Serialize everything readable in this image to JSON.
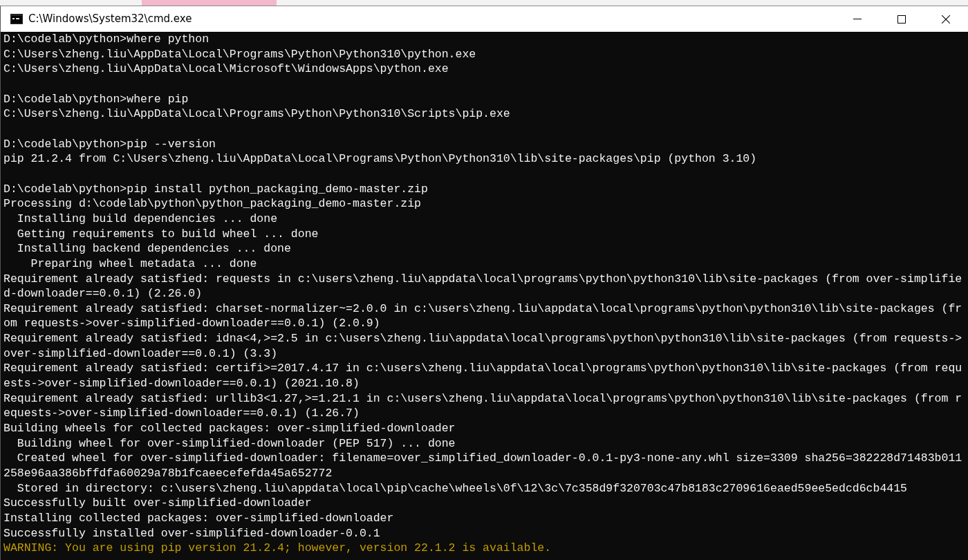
{
  "window": {
    "title": "C:\\Windows\\System32\\cmd.exe"
  },
  "console": {
    "blocks": [
      {
        "lines": [
          {
            "kind": "normal",
            "text": "D:\\codelab\\python>where python"
          },
          {
            "kind": "normal",
            "text": "C:\\Users\\zheng.liu\\AppData\\Local\\Programs\\Python\\Python310\\python.exe"
          },
          {
            "kind": "normal",
            "text": "C:\\Users\\zheng.liu\\AppData\\Local\\Microsoft\\WindowsApps\\python.exe"
          }
        ]
      },
      {
        "lines": [
          {
            "kind": "normal",
            "text": "D:\\codelab\\python>where pip"
          },
          {
            "kind": "normal",
            "text": "C:\\Users\\zheng.liu\\AppData\\Local\\Programs\\Python\\Python310\\Scripts\\pip.exe"
          }
        ]
      },
      {
        "lines": [
          {
            "kind": "normal",
            "text": "D:\\codelab\\python>pip --version"
          },
          {
            "kind": "normal",
            "text": "pip 21.2.4 from C:\\Users\\zheng.liu\\AppData\\Local\\Programs\\Python\\Python310\\lib\\site-packages\\pip (python 3.10)"
          }
        ]
      },
      {
        "lines": [
          {
            "kind": "normal",
            "text": "D:\\codelab\\python>pip install python_packaging_demo-master.zip"
          },
          {
            "kind": "normal",
            "text": "Processing d:\\codelab\\python\\python_packaging_demo-master.zip"
          },
          {
            "kind": "normal",
            "text": "  Installing build dependencies ... done"
          },
          {
            "kind": "normal",
            "text": "  Getting requirements to build wheel ... done"
          },
          {
            "kind": "normal",
            "text": "  Installing backend dependencies ... done"
          },
          {
            "kind": "normal",
            "text": "    Preparing wheel metadata ... done"
          },
          {
            "kind": "normal",
            "text": "Requirement already satisfied: requests in c:\\users\\zheng.liu\\appdata\\local\\programs\\python\\python310\\lib\\site-packages (from over-simplifie"
          },
          {
            "kind": "normal",
            "text": "d-downloader==0.0.1) (2.26.0)"
          },
          {
            "kind": "normal",
            "text": "Requirement already satisfied: charset-normalizer~=2.0.0 in c:\\users\\zheng.liu\\appdata\\local\\programs\\python\\python310\\lib\\site-packages (fr"
          },
          {
            "kind": "normal",
            "text": "om requests->over-simplified-downloader==0.0.1) (2.0.9)"
          },
          {
            "kind": "normal",
            "text": "Requirement already satisfied: idna<4,>=2.5 in c:\\users\\zheng.liu\\appdata\\local\\programs\\python\\python310\\lib\\site-packages (from requests->"
          },
          {
            "kind": "normal",
            "text": "over-simplified-downloader==0.0.1) (3.3)"
          },
          {
            "kind": "normal",
            "text": "Requirement already satisfied: certifi>=2017.4.17 in c:\\users\\zheng.liu\\appdata\\local\\programs\\python\\python310\\lib\\site-packages (from requ"
          },
          {
            "kind": "normal",
            "text": "ests->over-simplified-downloader==0.0.1) (2021.10.8)"
          },
          {
            "kind": "normal",
            "text": "Requirement already satisfied: urllib3<1.27,>=1.21.1 in c:\\users\\zheng.liu\\appdata\\local\\programs\\python\\python310\\lib\\site-packages (from r"
          },
          {
            "kind": "normal",
            "text": "equests->over-simplified-downloader==0.0.1) (1.26.7)"
          },
          {
            "kind": "normal",
            "text": "Building wheels for collected packages: over-simplified-downloader"
          },
          {
            "kind": "normal",
            "text": "  Building wheel for over-simplified-downloader (PEP 517) ... done"
          },
          {
            "kind": "normal",
            "text": "  Created wheel for over-simplified-downloader: filename=over_simplified_downloader-0.0.1-py3-none-any.whl size=3309 sha256=382228d71483b011"
          },
          {
            "kind": "normal",
            "text": "258e96aa386bffdfa60029a78b1fcaeecefefda45a652772"
          },
          {
            "kind": "normal",
            "text": "  Stored in directory: c:\\users\\zheng.liu\\appdata\\local\\pip\\cache\\wheels\\0f\\12\\3c\\7c358d9f320703c47b8183c2709616eaed59ee5edcd6cb4415"
          },
          {
            "kind": "normal",
            "text": "Successfully built over-simplified-downloader"
          },
          {
            "kind": "normal",
            "text": "Installing collected packages: over-simplified-downloader"
          },
          {
            "kind": "normal",
            "text": "Successfully installed over-simplified-downloader-0.0.1"
          },
          {
            "kind": "warning",
            "text": "WARNING: You are using pip version 21.2.4; however, version 22.1.2 is available."
          }
        ]
      }
    ]
  }
}
